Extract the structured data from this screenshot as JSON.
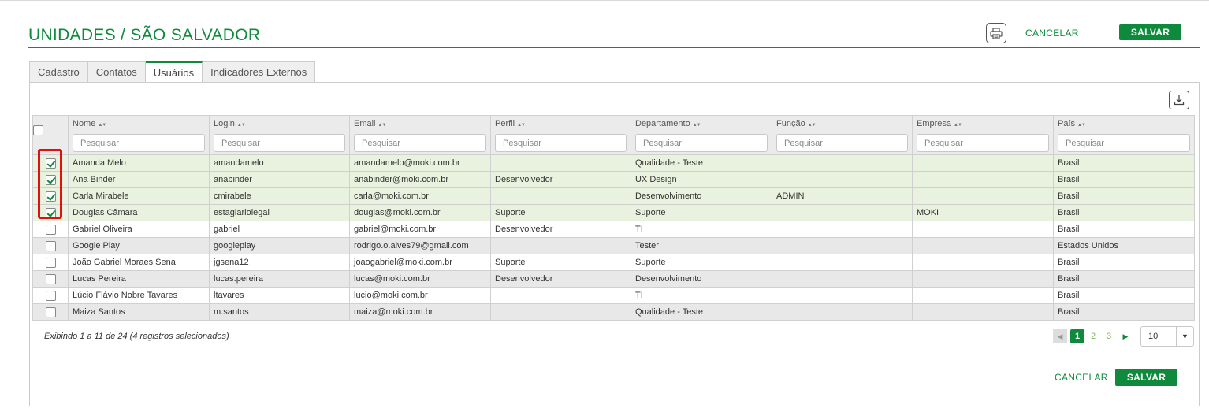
{
  "header": {
    "title": "UNIDADES / SÃO SALVADOR",
    "cancel_label": "CANCELAR",
    "save_label": "SALVAR"
  },
  "tabs": [
    {
      "label": "Cadastro",
      "active": false
    },
    {
      "label": "Contatos",
      "active": false
    },
    {
      "label": "Usuários",
      "active": true
    },
    {
      "label": "Indicadores Externos",
      "active": false
    }
  ],
  "table": {
    "columns": [
      {
        "label": "Nome",
        "placeholder": "Pesquisar"
      },
      {
        "label": "Login",
        "placeholder": "Pesquisar"
      },
      {
        "label": "Email",
        "placeholder": "Pesquisar"
      },
      {
        "label": "Perfil",
        "placeholder": "Pesquisar"
      },
      {
        "label": "Departamento",
        "placeholder": "Pesquisar"
      },
      {
        "label": "Função",
        "placeholder": "Pesquisar"
      },
      {
        "label": "Empresa",
        "placeholder": "Pesquisar"
      },
      {
        "label": "País",
        "placeholder": "Pesquisar"
      }
    ],
    "rows": [
      {
        "selected": true,
        "cells": [
          "Amanda Melo",
          "amandamelo",
          "amandamelo@moki.com.br",
          "",
          "Qualidade - Teste",
          "",
          "",
          "Brasil"
        ]
      },
      {
        "selected": true,
        "cells": [
          "Ana Binder",
          "anabinder",
          "anabinder@moki.com.br",
          "Desenvolvedor",
          "UX Design",
          "",
          "",
          "Brasil"
        ]
      },
      {
        "selected": true,
        "cells": [
          "Carla Mirabele",
          "cmirabele",
          "carla@moki.com.br",
          "",
          "Desenvolvimento",
          "ADMIN",
          "",
          "Brasil"
        ]
      },
      {
        "selected": true,
        "cells": [
          "Douglas Câmara",
          "estagiariolegal",
          "douglas@moki.com.br",
          "Suporte",
          "Suporte",
          "",
          "MOKI",
          "Brasil"
        ]
      },
      {
        "selected": false,
        "cells": [
          "Gabriel Oliveira",
          "gabriel",
          "gabriel@moki.com.br",
          "Desenvolvedor",
          "TI",
          "",
          "",
          "Brasil"
        ]
      },
      {
        "selected": false,
        "cells": [
          "Google Play",
          "googleplay",
          "rodrigo.o.alves79@gmail.com",
          "",
          "Tester",
          "",
          "",
          "Estados Unidos"
        ]
      },
      {
        "selected": false,
        "cells": [
          "João Gabriel Moraes Sena",
          "jgsena12",
          "joaogabriel@moki.com.br",
          "Suporte",
          "Suporte",
          "",
          "",
          "Brasil"
        ]
      },
      {
        "selected": false,
        "cells": [
          "Lucas Pereira",
          "lucas.pereira",
          "lucas@moki.com.br",
          "Desenvolvedor",
          "Desenvolvimento",
          "",
          "",
          "Brasil"
        ]
      },
      {
        "selected": false,
        "cells": [
          "Lúcio Flávio Nobre Tavares",
          "ltavares",
          "lucio@moki.com.br",
          "",
          "TI",
          "",
          "",
          "Brasil"
        ]
      },
      {
        "selected": false,
        "cells": [
          "Maiza Santos",
          "m.santos",
          "maiza@moki.com.br",
          "",
          "Qualidade - Teste",
          "",
          "",
          "Brasil"
        ]
      }
    ]
  },
  "footer": {
    "info": "Exibindo 1 a 11 de 24  (4 registros selecionados)",
    "pages": [
      "1",
      "2",
      "3"
    ],
    "current_page": "1",
    "page_size": "10",
    "cancel_label": "CANCELAR",
    "save_label": "SALVAR"
  },
  "icons": {
    "print": "printer-icon",
    "download": "download-icon",
    "sort": "sort-icon",
    "prev": "caret-left-icon",
    "next": "caret-right-icon",
    "dropdown": "caret-down-icon"
  },
  "colors": {
    "brand_green": "#0f8a3c",
    "selected_row": "#e9f2de",
    "alt_row": "#e8e8e8",
    "highlight_box": "#e01010"
  }
}
